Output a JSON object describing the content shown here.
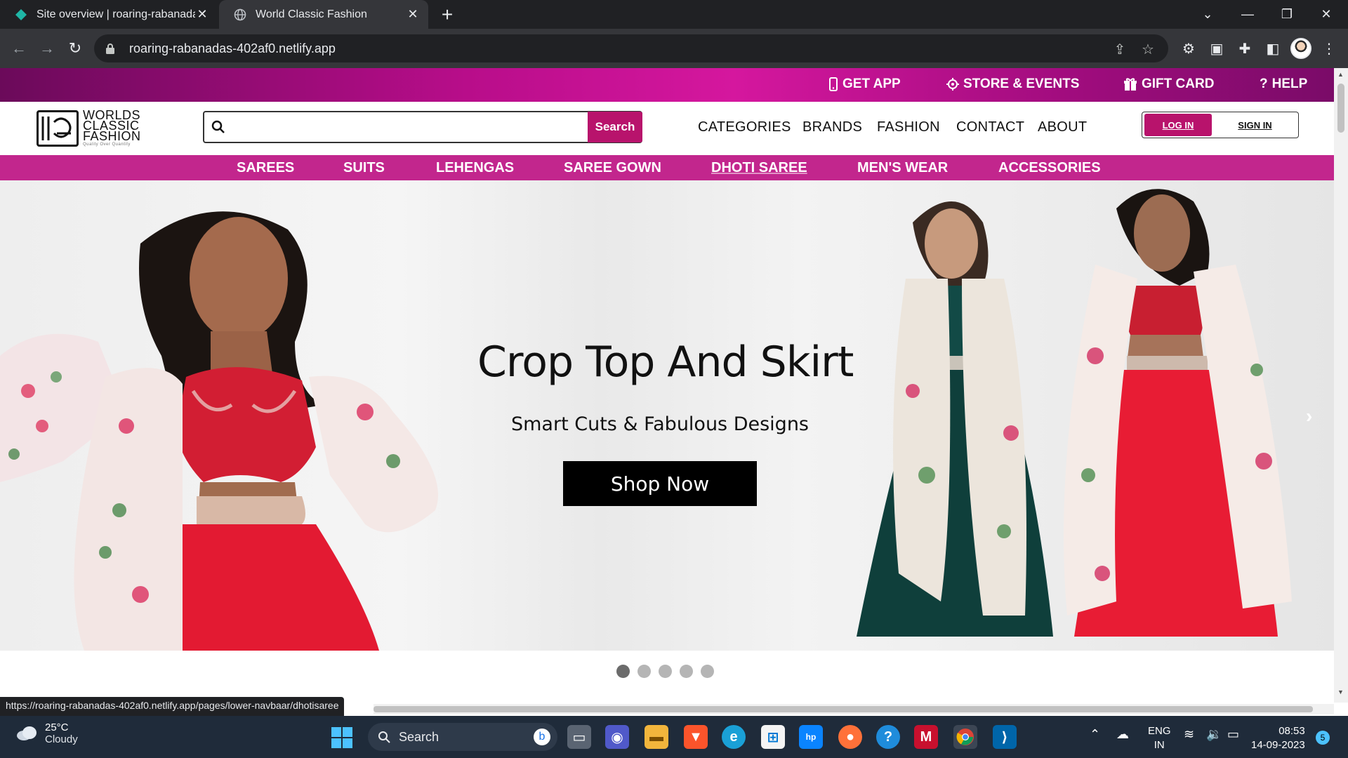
{
  "browser": {
    "tabs": [
      {
        "title": "Site overview | roaring-rabanadas",
        "active": false
      },
      {
        "title": "World Classic Fashion",
        "active": true
      }
    ],
    "url": "roaring-rabanadas-402af0.netlify.app",
    "status_url": "https://roaring-rabanadas-402af0.netlify.app/pages/lower-navbaar/dhotisaree"
  },
  "topbar": {
    "get_app": "GET APP",
    "store_events": "STORE & EVENTS",
    "gift_card": "GIFT CARD",
    "help": "HELP"
  },
  "header": {
    "logo_line1": "WORLDS",
    "logo_line2": "CLASSIC",
    "logo_line3": "FASHION",
    "logo_tagline": "Quality Over Quantity",
    "search_placeholder": "",
    "search_button": "Search",
    "nav": [
      "CATEGORIES",
      "BRANDS",
      "FASHION",
      "CONTACT",
      "ABOUT"
    ],
    "login": "LOG IN",
    "signin": "SIGN IN"
  },
  "categories": [
    "SAREES",
    "SUITS",
    "LEHENGAS",
    "SAREE GOWN",
    "DHOTI SAREE",
    "MEN'S WEAR",
    "ACCESSORIES"
  ],
  "hero": {
    "title": "Crop Top And Skirt",
    "subtitle": "Smart Cuts & Fabulous Designs",
    "cta": "Shop Now",
    "next_arrow": "›",
    "slide_count": 5,
    "active_slide": 1
  },
  "taskbar": {
    "temperature": "25°C",
    "weather": "Cloudy",
    "search": "Search",
    "lang1": "ENG",
    "lang2": "IN",
    "time": "08:53",
    "date": "14-09-2023",
    "notifications": "5"
  },
  "colors": {
    "brand_pink": "#b8136c",
    "category_bar": "#c2268d",
    "top_gradient_mid": "#d5179e"
  }
}
